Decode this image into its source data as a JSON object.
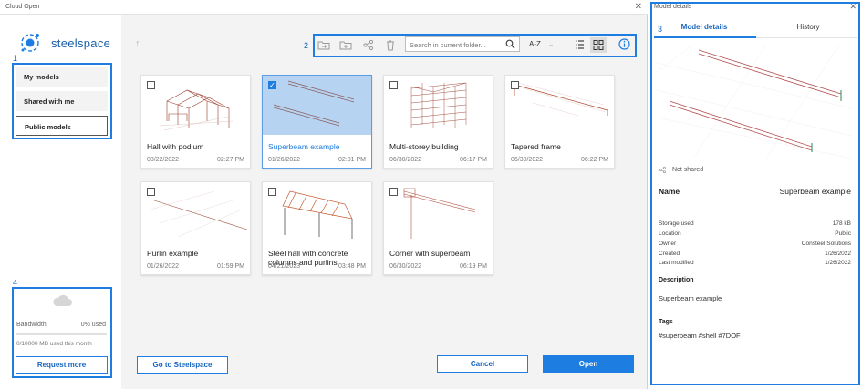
{
  "window": {
    "title": "Cloud Open",
    "close_glyph": "✕"
  },
  "brand": {
    "name": "steelspace",
    "logo_icon": "steelspace-logo-icon"
  },
  "annotations": {
    "nav": "1",
    "toolbar": "2",
    "details": "3",
    "bandwidth": "4"
  },
  "sidebar": {
    "items": [
      {
        "label": "My models",
        "active": false
      },
      {
        "label": "Shared with me",
        "active": false
      },
      {
        "label": "Public models",
        "active": true
      }
    ]
  },
  "bandwidth": {
    "label": "Bandwidth",
    "used": "0% used",
    "used_fraction": 0,
    "detail": "0/10000 MB used this month",
    "request_label": "Request more"
  },
  "toolbar": {
    "search_placeholder": "Search in current folder...",
    "sort_label": "A-Z",
    "icons": [
      "move-folder-icon",
      "new-folder-icon",
      "share-icon",
      "delete-icon"
    ]
  },
  "cards": [
    {
      "name": "Hall with podium",
      "date": "08/22/2022",
      "time": "02:27 PM",
      "selected": false
    },
    {
      "name": "Superbeam example",
      "date": "01/26/2022",
      "time": "02:01 PM",
      "selected": true
    },
    {
      "name": "Multi-storey building",
      "date": "06/30/2022",
      "time": "06:17 PM",
      "selected": false
    },
    {
      "name": "Tapered frame",
      "date": "06/30/2022",
      "time": "06:22 PM",
      "selected": false
    },
    {
      "name": "Purlin example",
      "date": "01/26/2022",
      "time": "01:59 PM",
      "selected": false
    },
    {
      "name": "Steel hall with concrete columns and purlins",
      "date": "04/21/2023",
      "time": "03:48 PM",
      "selected": false
    },
    {
      "name": "Corner with superbeam",
      "date": "06/30/2022",
      "time": "06:19 PM",
      "selected": false
    }
  ],
  "buttons": {
    "go": "Go to Steelspace",
    "cancel": "Cancel",
    "open": "Open"
  },
  "details": {
    "title": "Model details",
    "tabs": [
      "Model details",
      "History"
    ],
    "share_status": "Not shared",
    "name_label": "Name",
    "name_value": "Superbeam example",
    "props": [
      {
        "label": "Storage used",
        "value": "178 kB"
      },
      {
        "label": "Location",
        "value": "Public"
      },
      {
        "label": "Owner",
        "value": "Consteel Solutions"
      },
      {
        "label": "Created",
        "value": "1/26/2022"
      },
      {
        "label": "Last modified",
        "value": "1/26/2022"
      }
    ],
    "description_label": "Description",
    "description": "Superbeam example",
    "tags_label": "Tags",
    "tags": "#superbeam #shell #7DOF"
  },
  "colors": {
    "accent": "#1e7de0",
    "brand": "#1a5fa8",
    "selection": "#b6d4f2"
  }
}
